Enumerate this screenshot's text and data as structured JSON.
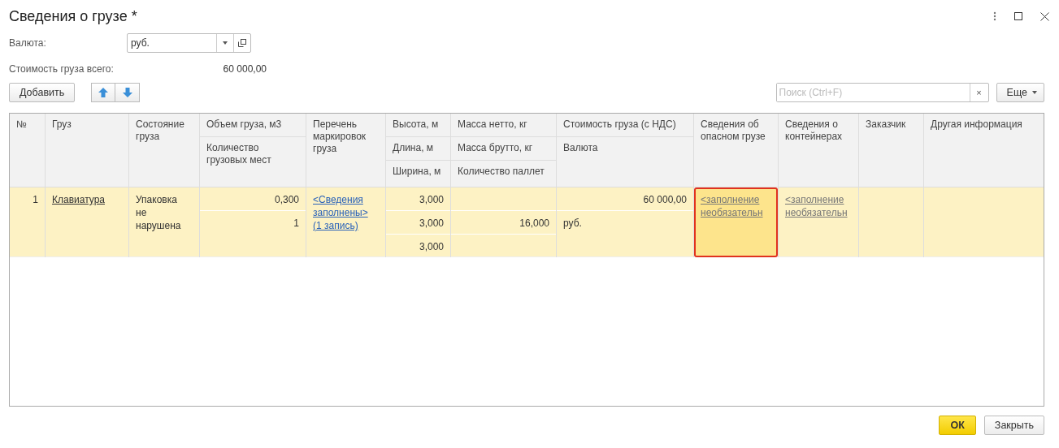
{
  "window": {
    "title": "Сведения о грузе *"
  },
  "currency": {
    "label": "Валюта:",
    "value": "руб."
  },
  "total": {
    "label": "Стоимость груза всего:",
    "value": "60 000,00"
  },
  "toolbar": {
    "add_button": "Добавить",
    "search": {
      "placeholder": "Поиск (Ctrl+F)",
      "clear": "×"
    },
    "more_button": "Еще"
  },
  "table": {
    "columns": [
      {
        "headers": [
          "№"
        ]
      },
      {
        "headers": [
          "Груз"
        ]
      },
      {
        "headers": [
          "Состояние груза"
        ]
      },
      {
        "headers": [
          "Объем груза, м3",
          "Количество грузовых мест"
        ]
      },
      {
        "headers": [
          "Перечень маркировок груза"
        ]
      },
      {
        "headers": [
          "Высота, м",
          "Длина, м",
          "Ширина, м"
        ]
      },
      {
        "headers": [
          "Масса нетто, кг",
          "Масса брутто, кг",
          "Количество паллет"
        ]
      },
      {
        "headers": [
          "Стоимость груза (с НДС)",
          "Валюта"
        ]
      },
      {
        "headers": [
          "Сведения об опасном грузе"
        ]
      },
      {
        "headers": [
          "Сведения о контейнерах"
        ]
      },
      {
        "headers": [
          "Заказчик"
        ]
      },
      {
        "headers": [
          "Другая информация"
        ]
      }
    ],
    "rows": [
      {
        "selected": true,
        "cells": [
          {
            "current": false,
            "values": [
              {
                "kind": "number",
                "text": "1"
              }
            ]
          },
          {
            "current": false,
            "values": [
              {
                "kind": "ref",
                "text": "Клавиатура"
              }
            ]
          },
          {
            "current": false,
            "values": [
              {
                "kind": "text",
                "text": "Упаковка не нарушена"
              }
            ]
          },
          {
            "current": false,
            "values": [
              {
                "kind": "number",
                "text": "0,300"
              },
              {
                "kind": "number",
                "text": "1"
              }
            ]
          },
          {
            "current": false,
            "values": [
              {
                "kind": "link",
                "text": "<Сведения заполнены> (1 запись)"
              }
            ]
          },
          {
            "current": false,
            "values": [
              {
                "kind": "number",
                "text": "3,000"
              },
              {
                "kind": "number",
                "text": "3,000"
              },
              {
                "kind": "number",
                "text": "3,000"
              }
            ]
          },
          {
            "current": false,
            "values": [
              {
                "kind": "empty"
              },
              {
                "kind": "number",
                "text": "16,000"
              },
              {
                "kind": "empty"
              }
            ]
          },
          {
            "current": false,
            "values": [
              {
                "kind": "number",
                "text": "60 000,00"
              },
              {
                "kind": "text",
                "text": "руб."
              }
            ]
          },
          {
            "current": true,
            "values": [
              {
                "kind": "hint",
                "text": "<заполнение необязательн"
              }
            ]
          },
          {
            "current": false,
            "values": [
              {
                "kind": "hint",
                "text": "<заполнение необязательн"
              }
            ]
          },
          {
            "current": false,
            "values": [
              {
                "kind": "empty"
              }
            ]
          },
          {
            "current": false,
            "values": [
              {
                "kind": "empty"
              }
            ]
          }
        ]
      }
    ]
  },
  "buttons": {
    "ok": "ОК",
    "close": "Закрыть"
  }
}
